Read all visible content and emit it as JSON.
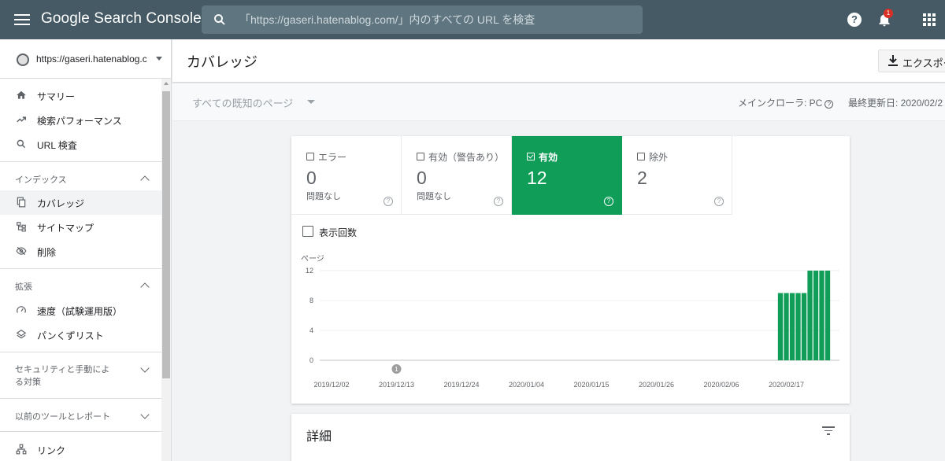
{
  "header": {
    "brand": "Google Search Console",
    "search_placeholder": "「https://gaseri.hatenablog.com/」内のすべての URL を検査",
    "notification_count": "1",
    "help_glyph": "?"
  },
  "sidebar": {
    "property_url": "https://gaseri.hatenablog.co...",
    "top_items": [
      {
        "label": "サマリー",
        "icon": "home-icon"
      },
      {
        "label": "検索パフォーマンス",
        "icon": "trending-up-icon"
      },
      {
        "label": "URL 検査",
        "icon": "search-icon"
      }
    ],
    "sections": [
      {
        "label": "インデックス",
        "items": [
          {
            "label": "カバレッジ",
            "icon": "coverage-icon",
            "active": true
          },
          {
            "label": "サイトマップ",
            "icon": "sitemap-icon"
          },
          {
            "label": "削除",
            "icon": "remove-icon"
          }
        ]
      },
      {
        "label": "拡張",
        "items": [
          {
            "label": "速度（試験運用版）",
            "icon": "speed-icon"
          },
          {
            "label": "パンくずリスト",
            "icon": "breadcrumb-icon"
          }
        ]
      },
      {
        "label": "セキュリティと手動による対策"
      },
      {
        "label": "以前のツールとレポート",
        "items": [
          {
            "label": "リンク",
            "icon": "links-icon"
          }
        ]
      }
    ]
  },
  "page": {
    "title": "カバレッジ",
    "export_label": "エクスポー"
  },
  "filter": {
    "pages_select": "すべての既知のページ",
    "crawler": "メインクローラ: PC",
    "last_updated": "最終更新日: 2020/02/2"
  },
  "tiles": [
    {
      "label": "エラー",
      "value": "0",
      "sub": "問題なし",
      "active": false
    },
    {
      "label": "有効（警告あり）",
      "value": "0",
      "sub": "問題なし",
      "active": false
    },
    {
      "label": "有効",
      "value": "12",
      "sub": "",
      "active": true
    },
    {
      "label": "除外",
      "value": "2",
      "sub": "",
      "active": false
    }
  ],
  "impressions_label": "表示回数",
  "chart_data": {
    "type": "bar",
    "ylabel": "ページ",
    "ylim": [
      0,
      12
    ],
    "yticks": [
      0,
      4,
      8,
      12
    ],
    "xtick_labels": [
      "2019/12/02",
      "2019/12/13",
      "2019/12/24",
      "2020/01/04",
      "2020/01/15",
      "2020/01/26",
      "2020/02/06",
      "2020/02/17"
    ],
    "x_start": "2019/11/30",
    "x_end": "2020/02/26",
    "bars": [
      {
        "date": "2020/02/16",
        "value": 9
      },
      {
        "date": "2020/02/17",
        "value": 9
      },
      {
        "date": "2020/02/18",
        "value": 9
      },
      {
        "date": "2020/02/19",
        "value": 9
      },
      {
        "date": "2020/02/20",
        "value": 9
      },
      {
        "date": "2020/02/21",
        "value": 12
      },
      {
        "date": "2020/02/22",
        "value": 12
      },
      {
        "date": "2020/02/23",
        "value": 12
      },
      {
        "date": "2020/02/24",
        "value": 12
      }
    ],
    "annotations": [
      {
        "date": "2019/12/13",
        "label": "1"
      }
    ],
    "bar_color": "#0f9d58",
    "grid": true
  },
  "details": {
    "title": "詳細"
  }
}
